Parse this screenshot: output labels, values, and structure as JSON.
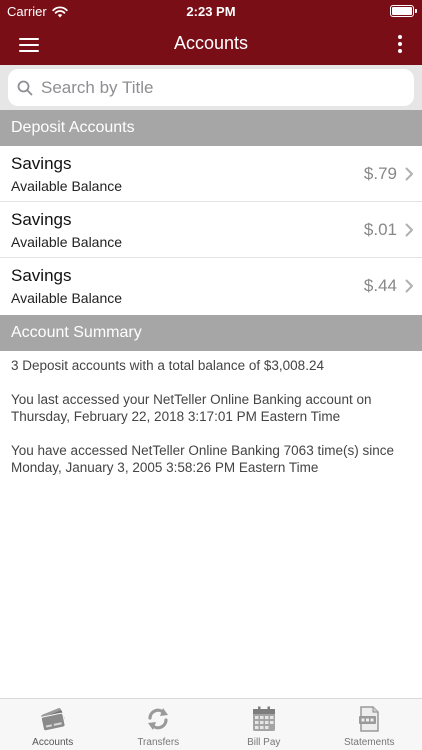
{
  "status_bar": {
    "carrier": "Carrier",
    "time": "2:23 PM"
  },
  "nav": {
    "title": "Accounts"
  },
  "search": {
    "placeholder": "Search by Title",
    "value": ""
  },
  "sections": {
    "deposit": "Deposit Accounts",
    "summary": "Account Summary"
  },
  "accounts": [
    {
      "name": "Savings",
      "subtitle": "Available Balance",
      "balance": "$.79"
    },
    {
      "name": "Savings",
      "subtitle": "Available Balance",
      "balance": "$.01"
    },
    {
      "name": "Savings",
      "subtitle": "Available Balance",
      "balance": "$.44"
    }
  ],
  "summary": {
    "line1": "3 Deposit accounts with a total balance of $3,008.24",
    "line2": "You last accessed your NetTeller Online Banking account on Thursday, February 22, 2018 3:17:01 PM Eastern Time",
    "line3": "You have accessed NetTeller Online Banking 7063 time(s) since Monday, January 3, 2005 3:58:26 PM Eastern Time"
  },
  "tabs": [
    {
      "label": "Accounts",
      "icon": "credit-cards-icon",
      "active": true
    },
    {
      "label": "Transfers",
      "icon": "transfer-arrows-icon",
      "active": false
    },
    {
      "label": "Bill Pay",
      "icon": "calendar-icon",
      "active": false
    },
    {
      "label": "Statements",
      "icon": "pdf-document-icon",
      "active": false
    }
  ],
  "colors": {
    "brand": "#7a0e17",
    "section_header": "#a6a6a6",
    "search_bg": "#e6e6e6"
  }
}
